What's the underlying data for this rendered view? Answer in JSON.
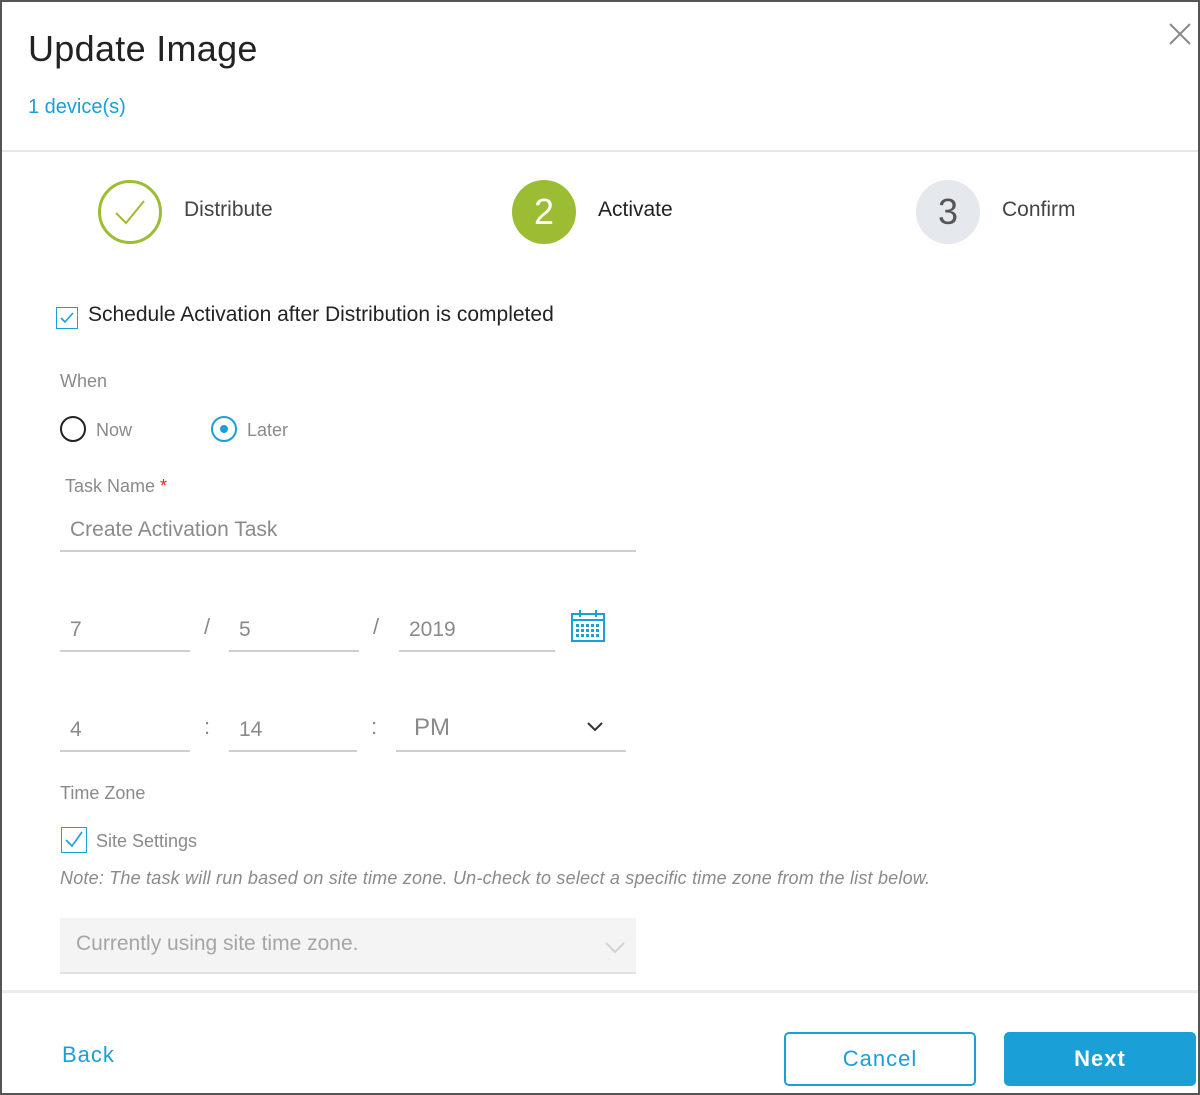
{
  "header": {
    "title": "Update Image",
    "subtitle": "1 device(s)",
    "close_icon": "close-icon"
  },
  "steps": [
    {
      "number": "",
      "label": "Distribute",
      "state": "completed",
      "icon": "check-icon"
    },
    {
      "number": "2",
      "label": "Activate",
      "state": "active"
    },
    {
      "number": "3",
      "label": "Confirm",
      "state": "pending"
    }
  ],
  "schedule": {
    "checkbox_label": "Schedule Activation after Distribution is completed",
    "checked": true
  },
  "when": {
    "label": "When",
    "options": [
      {
        "label": "Now",
        "selected": false
      },
      {
        "label": "Later",
        "selected": true
      }
    ]
  },
  "task_name": {
    "label": "Task Name",
    "required_marker": "*",
    "value": "Create Activation Task"
  },
  "date": {
    "month": "7",
    "day": "5",
    "year": "2019",
    "separator": "/",
    "icon": "calendar-icon"
  },
  "time": {
    "hour": "4",
    "minute": "14",
    "meridiem": "PM",
    "separator": ":"
  },
  "timezone": {
    "label": "Time Zone",
    "site_settings_label": "Site Settings",
    "site_settings_checked": true,
    "note": "Note: The task will run based on site time zone. Un-check to select a specific time zone from the list below.",
    "select_value": "Currently using site time zone."
  },
  "footer": {
    "back_label": "Back",
    "cancel_label": "Cancel",
    "next_label": "Next"
  },
  "colors": {
    "accent": "#1a9fd6",
    "step_green": "#9cbd33",
    "pending_step": "#e5e9ee"
  }
}
